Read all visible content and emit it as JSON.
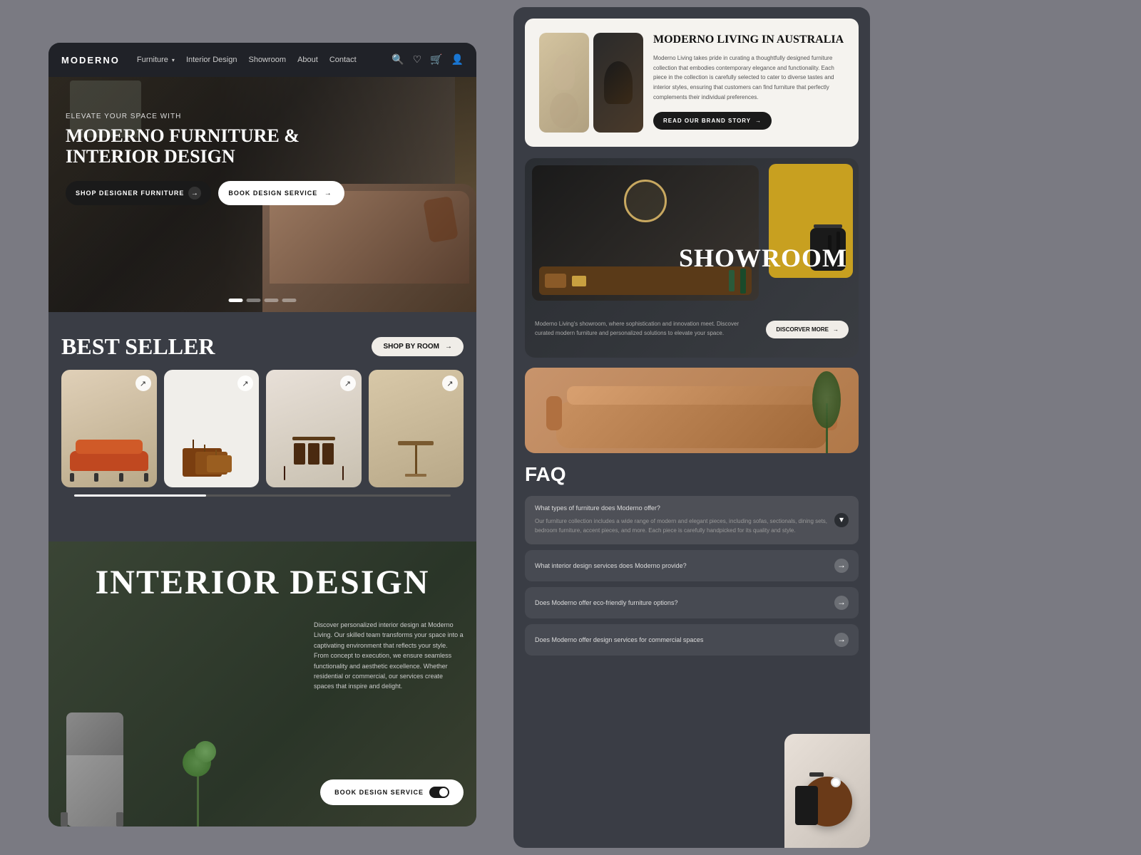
{
  "brand": {
    "name": "MODERNO"
  },
  "nav": {
    "links": [
      {
        "id": "furniture",
        "label": "Furniture",
        "hasDropdown": true
      },
      {
        "id": "interior-design",
        "label": "Interior Design"
      },
      {
        "id": "showroom",
        "label": "Showroom"
      },
      {
        "id": "about",
        "label": "About"
      },
      {
        "id": "contact",
        "label": "Contact"
      }
    ]
  },
  "hero": {
    "subtitle": "ELEVATE YOUR SPACE WITH",
    "title": "MODERNO FURNITURE & INTERIOR DESIGN",
    "cta_primary": "SHOP DESIGNER FURNITURE",
    "cta_secondary": "BOOK DESIGN SERVICE",
    "dots": 4
  },
  "best_seller": {
    "title": "BEST SELLER",
    "shop_by_room": "SHOP BY ROOM"
  },
  "interior_design": {
    "title": "INTERIOR DESIGN",
    "description": "Discover personalized interior design at Moderno Living. Our skilled team transforms your space into a captivating environment that reflects your style. From concept to execution, we ensure seamless functionality and aesthetic excellence. Whether residential or commercial, our services create spaces that inspire and delight.",
    "cta": "BOOK DESIGN SERVICE"
  },
  "about": {
    "title": "MODERNO LIVING IN AUSTRALIA",
    "description": "Moderno Living takes pride in curating a thoughtfully designed furniture collection that embodies contemporary elegance and functionality. Each piece in the collection is carefully selected to cater to diverse tastes and interior styles, ensuring that customers can find furniture that perfectly complements their individual preferences.",
    "cta": "READ OUR BRAND STORY"
  },
  "showroom": {
    "title": "SHOWROOM",
    "description": "Moderno Living's showroom, where sophistication and innovation meet. Discover curated modern furniture and personalized solutions to elevate your space.",
    "cta": "DISCORVER MORE"
  },
  "faq": {
    "title": "FAQ",
    "items": [
      {
        "question": "What types of furniture does Moderno offer?",
        "answer": "Our furniture collection includes a wide range of modern and elegant pieces, including sofas, sectionals, dining sets, bedroom furniture, accent pieces, and more. Each piece is carefully handpicked for its quality and style.",
        "open": true
      },
      {
        "question": "What interior design services does Moderno provide?",
        "answer": "",
        "open": false
      },
      {
        "question": "Does Moderno offer eco-friendly furniture options?",
        "answer": "",
        "open": false
      },
      {
        "question": "Does Moderno offer design services for commercial spaces",
        "answer": "",
        "open": false
      }
    ]
  },
  "icons": {
    "search": "🔍",
    "wishlist": "♡",
    "cart": "🛒",
    "user": "👤",
    "arrow_right": "→",
    "arrow_up_right": "↗",
    "chevron_down": "▾",
    "circle_arrow": "⟶"
  }
}
